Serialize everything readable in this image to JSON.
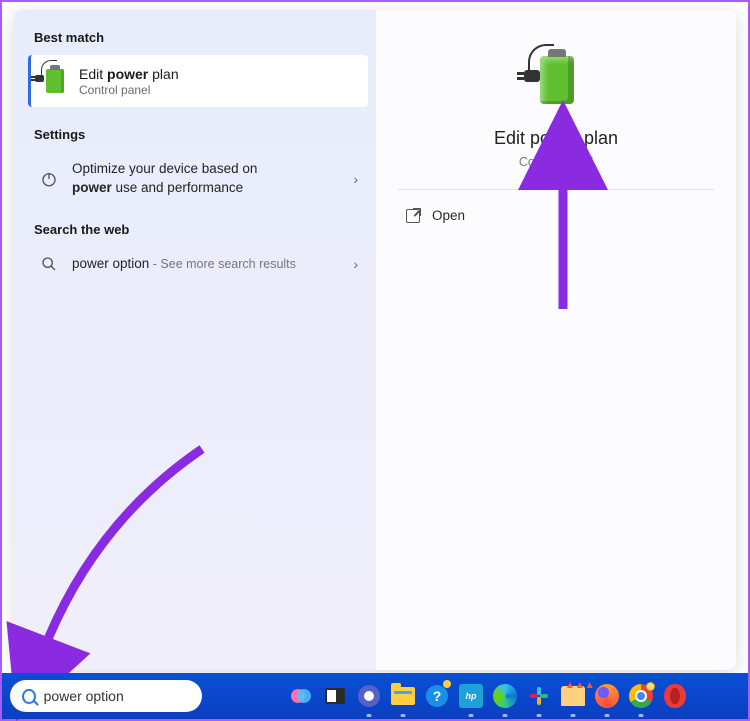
{
  "left": {
    "best_match_header": "Best match",
    "selected": {
      "title_prefix": "Edit ",
      "title_bold": "power",
      "title_suffix": " plan",
      "subtitle": "Control panel"
    },
    "settings_header": "Settings",
    "settings_item": {
      "line1": "Optimize your device based on",
      "line2_bold": "power",
      "line2_suffix": " use and performance"
    },
    "web_header": "Search the web",
    "web_item": {
      "term": "power option",
      "suffix": " - See more search results"
    }
  },
  "preview": {
    "title": "Edit power plan",
    "subtitle": "Control panel",
    "open_label": "Open"
  },
  "taskbar": {
    "search_value": "power option",
    "icons": [
      "copilot",
      "task-view",
      "teams",
      "explorer",
      "get-help",
      "hp",
      "edge",
      "slack",
      "burn",
      "firefox",
      "chrome",
      "opera"
    ]
  },
  "colors": {
    "accent": "#8a2be2"
  }
}
